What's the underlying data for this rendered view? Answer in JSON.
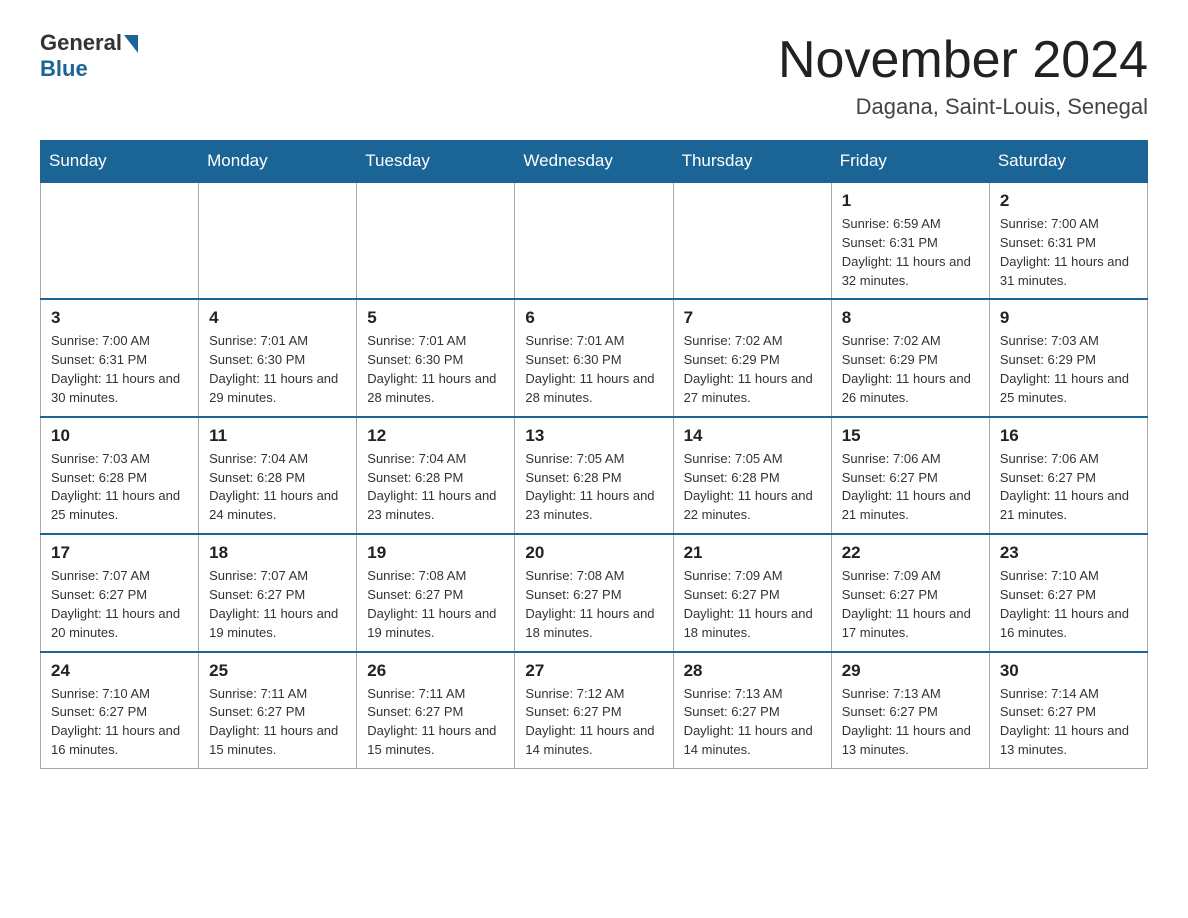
{
  "header": {
    "logo": {
      "general": "General",
      "blue": "Blue"
    },
    "title": "November 2024",
    "location": "Dagana, Saint-Louis, Senegal"
  },
  "weekdays": [
    "Sunday",
    "Monday",
    "Tuesday",
    "Wednesday",
    "Thursday",
    "Friday",
    "Saturday"
  ],
  "weeks": [
    [
      {
        "day": "",
        "info": ""
      },
      {
        "day": "",
        "info": ""
      },
      {
        "day": "",
        "info": ""
      },
      {
        "day": "",
        "info": ""
      },
      {
        "day": "",
        "info": ""
      },
      {
        "day": "1",
        "info": "Sunrise: 6:59 AM\nSunset: 6:31 PM\nDaylight: 11 hours and 32 minutes."
      },
      {
        "day": "2",
        "info": "Sunrise: 7:00 AM\nSunset: 6:31 PM\nDaylight: 11 hours and 31 minutes."
      }
    ],
    [
      {
        "day": "3",
        "info": "Sunrise: 7:00 AM\nSunset: 6:31 PM\nDaylight: 11 hours and 30 minutes."
      },
      {
        "day": "4",
        "info": "Sunrise: 7:01 AM\nSunset: 6:30 PM\nDaylight: 11 hours and 29 minutes."
      },
      {
        "day": "5",
        "info": "Sunrise: 7:01 AM\nSunset: 6:30 PM\nDaylight: 11 hours and 28 minutes."
      },
      {
        "day": "6",
        "info": "Sunrise: 7:01 AM\nSunset: 6:30 PM\nDaylight: 11 hours and 28 minutes."
      },
      {
        "day": "7",
        "info": "Sunrise: 7:02 AM\nSunset: 6:29 PM\nDaylight: 11 hours and 27 minutes."
      },
      {
        "day": "8",
        "info": "Sunrise: 7:02 AM\nSunset: 6:29 PM\nDaylight: 11 hours and 26 minutes."
      },
      {
        "day": "9",
        "info": "Sunrise: 7:03 AM\nSunset: 6:29 PM\nDaylight: 11 hours and 25 minutes."
      }
    ],
    [
      {
        "day": "10",
        "info": "Sunrise: 7:03 AM\nSunset: 6:28 PM\nDaylight: 11 hours and 25 minutes."
      },
      {
        "day": "11",
        "info": "Sunrise: 7:04 AM\nSunset: 6:28 PM\nDaylight: 11 hours and 24 minutes."
      },
      {
        "day": "12",
        "info": "Sunrise: 7:04 AM\nSunset: 6:28 PM\nDaylight: 11 hours and 23 minutes."
      },
      {
        "day": "13",
        "info": "Sunrise: 7:05 AM\nSunset: 6:28 PM\nDaylight: 11 hours and 23 minutes."
      },
      {
        "day": "14",
        "info": "Sunrise: 7:05 AM\nSunset: 6:28 PM\nDaylight: 11 hours and 22 minutes."
      },
      {
        "day": "15",
        "info": "Sunrise: 7:06 AM\nSunset: 6:27 PM\nDaylight: 11 hours and 21 minutes."
      },
      {
        "day": "16",
        "info": "Sunrise: 7:06 AM\nSunset: 6:27 PM\nDaylight: 11 hours and 21 minutes."
      }
    ],
    [
      {
        "day": "17",
        "info": "Sunrise: 7:07 AM\nSunset: 6:27 PM\nDaylight: 11 hours and 20 minutes."
      },
      {
        "day": "18",
        "info": "Sunrise: 7:07 AM\nSunset: 6:27 PM\nDaylight: 11 hours and 19 minutes."
      },
      {
        "day": "19",
        "info": "Sunrise: 7:08 AM\nSunset: 6:27 PM\nDaylight: 11 hours and 19 minutes."
      },
      {
        "day": "20",
        "info": "Sunrise: 7:08 AM\nSunset: 6:27 PM\nDaylight: 11 hours and 18 minutes."
      },
      {
        "day": "21",
        "info": "Sunrise: 7:09 AM\nSunset: 6:27 PM\nDaylight: 11 hours and 18 minutes."
      },
      {
        "day": "22",
        "info": "Sunrise: 7:09 AM\nSunset: 6:27 PM\nDaylight: 11 hours and 17 minutes."
      },
      {
        "day": "23",
        "info": "Sunrise: 7:10 AM\nSunset: 6:27 PM\nDaylight: 11 hours and 16 minutes."
      }
    ],
    [
      {
        "day": "24",
        "info": "Sunrise: 7:10 AM\nSunset: 6:27 PM\nDaylight: 11 hours and 16 minutes."
      },
      {
        "day": "25",
        "info": "Sunrise: 7:11 AM\nSunset: 6:27 PM\nDaylight: 11 hours and 15 minutes."
      },
      {
        "day": "26",
        "info": "Sunrise: 7:11 AM\nSunset: 6:27 PM\nDaylight: 11 hours and 15 minutes."
      },
      {
        "day": "27",
        "info": "Sunrise: 7:12 AM\nSunset: 6:27 PM\nDaylight: 11 hours and 14 minutes."
      },
      {
        "day": "28",
        "info": "Sunrise: 7:13 AM\nSunset: 6:27 PM\nDaylight: 11 hours and 14 minutes."
      },
      {
        "day": "29",
        "info": "Sunrise: 7:13 AM\nSunset: 6:27 PM\nDaylight: 11 hours and 13 minutes."
      },
      {
        "day": "30",
        "info": "Sunrise: 7:14 AM\nSunset: 6:27 PM\nDaylight: 11 hours and 13 minutes."
      }
    ]
  ]
}
